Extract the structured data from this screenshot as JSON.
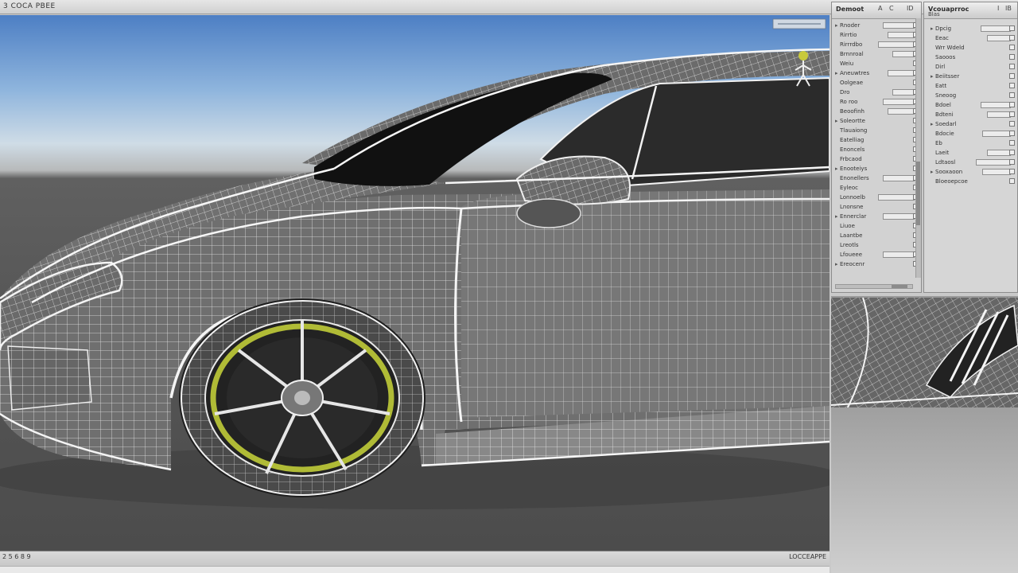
{
  "window": {
    "title": "3 COCA PBEE"
  },
  "status_bar": {
    "left_text": "2 5 6 8 9",
    "right_text": "LOCCEAPPE"
  },
  "icons": [
    "gizmo-figure-icon",
    "expand-arrow-icon",
    "collapse-arrow-icon",
    "checkbox-icon"
  ],
  "outliner": {
    "header_label": "Demoot",
    "header_controls": [
      "A",
      "C",
      "ID"
    ],
    "rows": [
      {
        "label": "Rnoder",
        "has_field": true
      },
      {
        "label": "Rirrtio",
        "has_field": true
      },
      {
        "label": "Rirrrdbo",
        "has_field": true
      },
      {
        "label": "Brnnroal",
        "has_field": true
      },
      {
        "label": "Weiu",
        "has_field": false
      },
      {
        "label": "Aneuwtres",
        "has_field": true
      },
      {
        "label": "Oolgeae",
        "has_field": false
      },
      {
        "label": "Dro",
        "has_field": true
      },
      {
        "label": "Ro roo",
        "has_field": true
      },
      {
        "label": "Beoofinh",
        "has_field": true
      },
      {
        "label": "Soleortte",
        "has_field": false
      },
      {
        "label": "Tlauaiong",
        "has_field": false
      },
      {
        "label": "Eatelliag",
        "has_field": false
      },
      {
        "label": "Enoncels",
        "has_field": false
      },
      {
        "label": "Frbcaod",
        "has_field": false
      },
      {
        "label": "Enooteiys",
        "has_field": false
      },
      {
        "label": "Enonellers",
        "has_field": true
      },
      {
        "label": "Eyleoc",
        "has_field": false
      },
      {
        "label": "Lonnoelb",
        "has_field": true
      },
      {
        "label": "Lnonsne",
        "has_field": false
      },
      {
        "label": "Ennerclar",
        "has_field": true
      },
      {
        "label": "Liuoe",
        "has_field": false
      },
      {
        "label": "Laantbe",
        "has_field": false
      },
      {
        "label": "Lreotls",
        "has_field": false
      },
      {
        "label": "Lfoueee",
        "has_field": true
      },
      {
        "label": "Ereocenr",
        "has_field": false
      }
    ]
  },
  "properties": {
    "header_label": "Vcouaprroc",
    "header_sub": "Blas",
    "header_controls": [
      "I",
      "IB"
    ],
    "rows": [
      {
        "label": "Dpcig",
        "has_field": true
      },
      {
        "label": "Eeac",
        "has_field": true
      },
      {
        "label": "Wrr Wdeld",
        "has_field": false
      },
      {
        "label": "Saooos",
        "has_field": false
      },
      {
        "label": "Dirl",
        "has_field": false
      },
      {
        "label": "Beiitsser",
        "has_field": false
      },
      {
        "label": "Eatt",
        "has_field": false
      },
      {
        "label": "Sneoog",
        "has_field": false
      },
      {
        "label": "Bdoel",
        "has_field": true
      },
      {
        "label": "Bdteni",
        "has_field": true
      },
      {
        "label": "Soedarl",
        "has_field": false
      },
      {
        "label": "Bdocie",
        "has_field": true
      },
      {
        "label": "Eb",
        "has_field": false
      },
      {
        "label": "Laeit",
        "has_field": true
      },
      {
        "label": "Ldtaosl",
        "has_field": true
      },
      {
        "label": "Sooxaoon",
        "has_field": true
      },
      {
        "label": "Bloeoepcoe",
        "has_field": false
      }
    ]
  }
}
